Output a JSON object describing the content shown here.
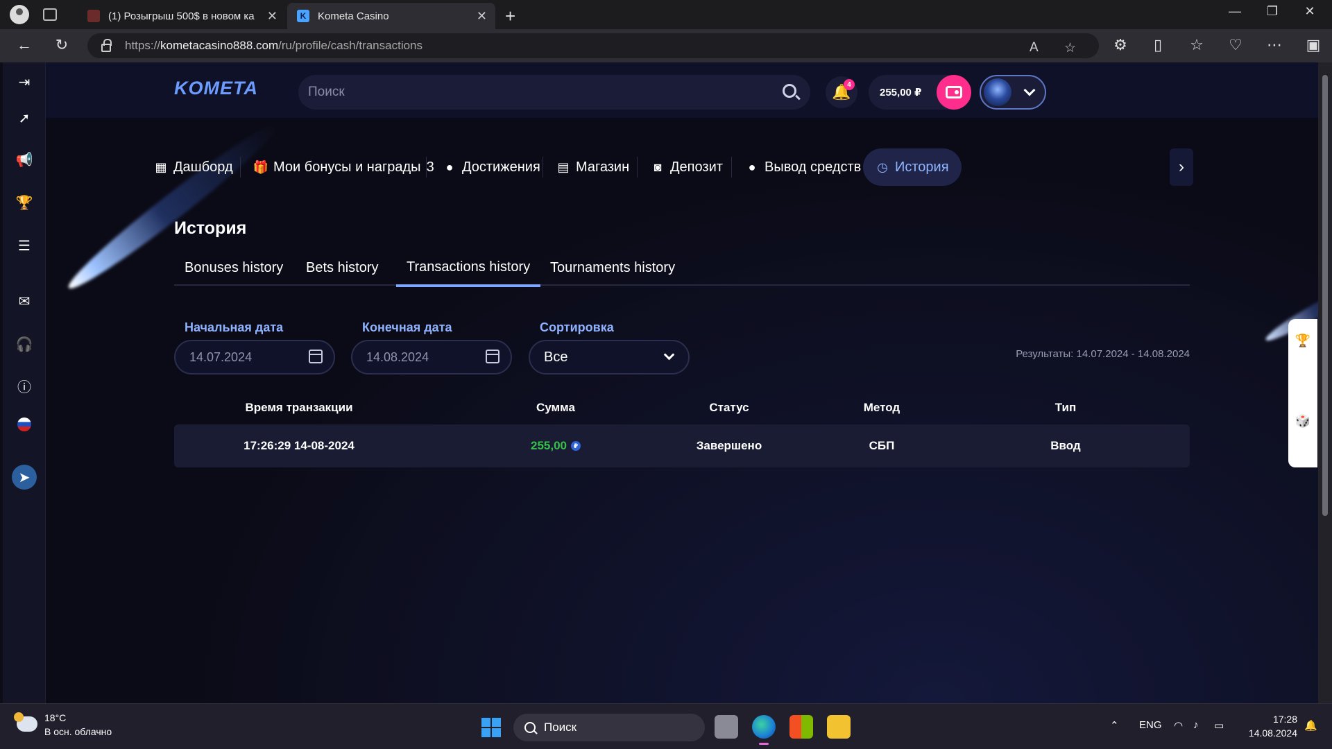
{
  "browser": {
    "tabs": [
      {
        "title": "(1) Розыгрыш 500$ в новом ка",
        "favicon": "app-favicon"
      },
      {
        "title": "Kometa Casino",
        "favicon": "K"
      }
    ],
    "url": {
      "prefix": "https://",
      "host": "kometacasino888.com",
      "path": "/ru/profile/cash/transactions"
    }
  },
  "header": {
    "logo": "KOMETA",
    "search_placeholder": "Поиск",
    "notifications_count": "4",
    "balance": "255,00 ₽"
  },
  "profile_nav": {
    "items": [
      {
        "label": "Дашборд",
        "icon": "dashboard-icon",
        "glyph": "▦"
      },
      {
        "label": "Мои бонусы и награды",
        "badge": "3",
        "icon": "gift-icon",
        "glyph": "🎁"
      },
      {
        "label": "Достижения",
        "icon": "medal-icon",
        "glyph": "●"
      },
      {
        "label": "Магазин",
        "icon": "shop-icon",
        "glyph": "▤"
      },
      {
        "label": "Депозит",
        "icon": "deposit-icon",
        "glyph": "◙"
      },
      {
        "label": "Вывод средств",
        "icon": "money-bag-icon",
        "glyph": "●"
      },
      {
        "label": "История",
        "icon": "clock-icon",
        "glyph": "◷",
        "active": true
      }
    ],
    "next": "›"
  },
  "history": {
    "title": "История",
    "subtabs": [
      {
        "label": "Bonuses history"
      },
      {
        "label": "Bets history"
      },
      {
        "label": "Transactions history",
        "active": true
      },
      {
        "label": "Tournaments history"
      }
    ],
    "filters": {
      "start_label": "Начальная дата",
      "start_value": "14.07.2024",
      "end_label": "Конечная дата",
      "end_value": "14.08.2024",
      "sort_label": "Сортировка",
      "sort_value": "Все"
    },
    "results": "Результаты: 14.07.2024 - 14.08.2024",
    "columns": [
      "Время транзакции",
      "Сумма",
      "Статус",
      "Метод",
      "Тип"
    ],
    "rows": [
      {
        "time": "17:26:29 14-08-2024",
        "amount": "255,00",
        "currency": "₽",
        "status": "Завершено",
        "method": "СБП",
        "type": "Ввод"
      }
    ]
  },
  "taskbar": {
    "temperature": "18°C",
    "weather": "В осн. облачно",
    "search_placeholder": "Поиск",
    "lang": "ENG",
    "time": "17:28",
    "date": "14.08.2024"
  },
  "colors": {
    "accent": "#7ea8ff",
    "pink": "#ff2d8c",
    "amount_green": "#35c24a",
    "background": "#0b0b17"
  }
}
